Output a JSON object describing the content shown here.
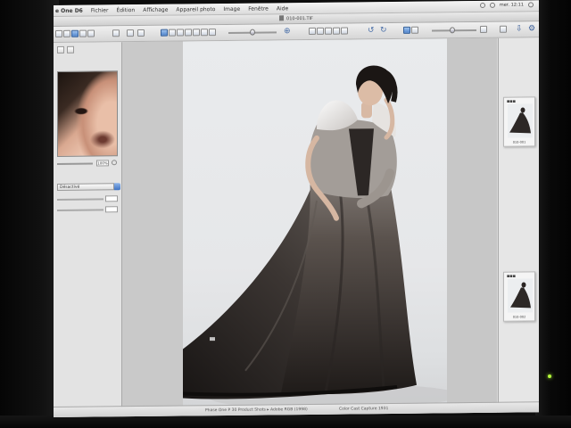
{
  "menubar": {
    "app": "e One D6",
    "items": [
      "Fichier",
      "Édition",
      "Affichage",
      "Appareil photo",
      "Image",
      "Fenêtre",
      "Aide"
    ],
    "clock": "mer. 12:11"
  },
  "window": {
    "filename": "010-001.TIF"
  },
  "left_panel": {
    "zoom_value": "100%",
    "lens_option": "Désactivé"
  },
  "browser": {
    "thumbnails": [
      {
        "name": "010-001"
      },
      {
        "name": "010-002"
      }
    ]
  },
  "statusbar": {
    "left": "Phase One P 30 Product Shots ▸ Adobe RGB (1998)",
    "right": "Color Cast Capture 1931"
  },
  "colors": {
    "accent": "#4f84cc",
    "dress": "#2f2a27",
    "background": "#e8e9eb"
  }
}
